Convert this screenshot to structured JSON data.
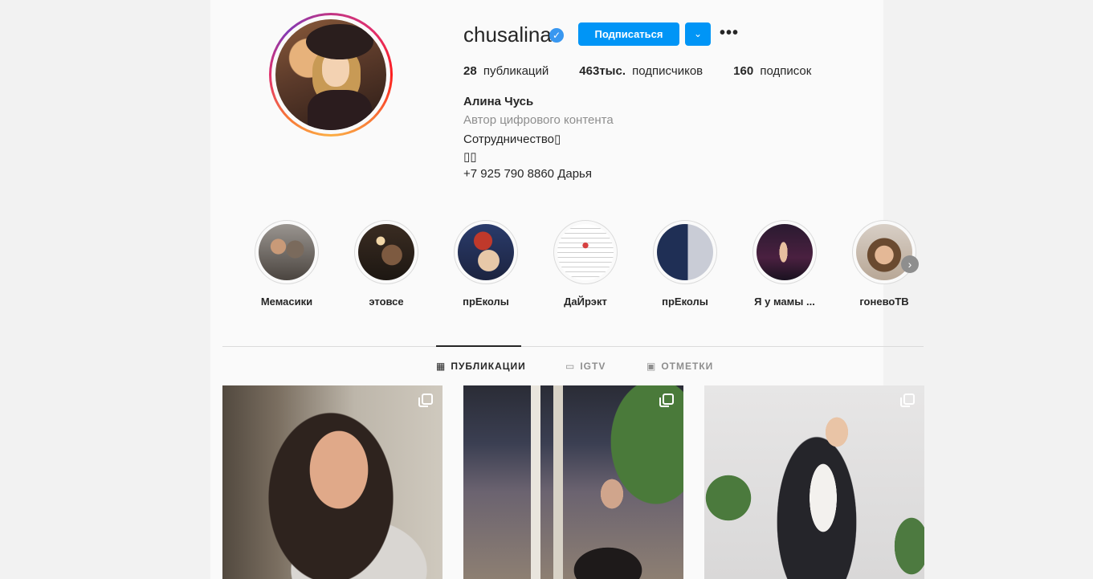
{
  "profile": {
    "username": "chusalina",
    "verified_icon": "verified-badge-icon",
    "follow_label": "Подписаться",
    "dropdown_glyph": "⌄",
    "more_glyph": "•••",
    "stats": {
      "posts_count": "28",
      "posts_label": "публикаций",
      "followers_count": "463тыс.",
      "followers_label": "подписчиков",
      "following_count": "160",
      "following_label": "подписок"
    },
    "full_name": "Алина Чусь",
    "category": "Автор цифрового контента",
    "bio_line1": "Сотрудничество▯",
    "bio_line2": "▯▯",
    "bio_line3": "+7 925 790 8860 Дарья"
  },
  "highlights": [
    {
      "label": "Мемасики"
    },
    {
      "label": "этовсе"
    },
    {
      "label": "прЕколы"
    },
    {
      "label": "ДаЙрэкт"
    },
    {
      "label": "прЕколы"
    },
    {
      "label": "Я у мамы ..."
    },
    {
      "label": "гоневоТВ"
    }
  ],
  "tabs": {
    "posts": "ПУБЛИКАЦИИ",
    "igtv": "IGTV",
    "tagged": "ОТМЕТКИ"
  },
  "icons": {
    "grid": "grid-icon",
    "igtv": "igtv-icon",
    "tagged": "tagged-icon",
    "carousel": "carousel-icon",
    "next": "chevron-right-icon"
  },
  "colors": {
    "accent": "#0095f6",
    "verified": "#3897f0",
    "text": "#262626",
    "muted": "#8e8e8e",
    "background": "#fafafa"
  }
}
